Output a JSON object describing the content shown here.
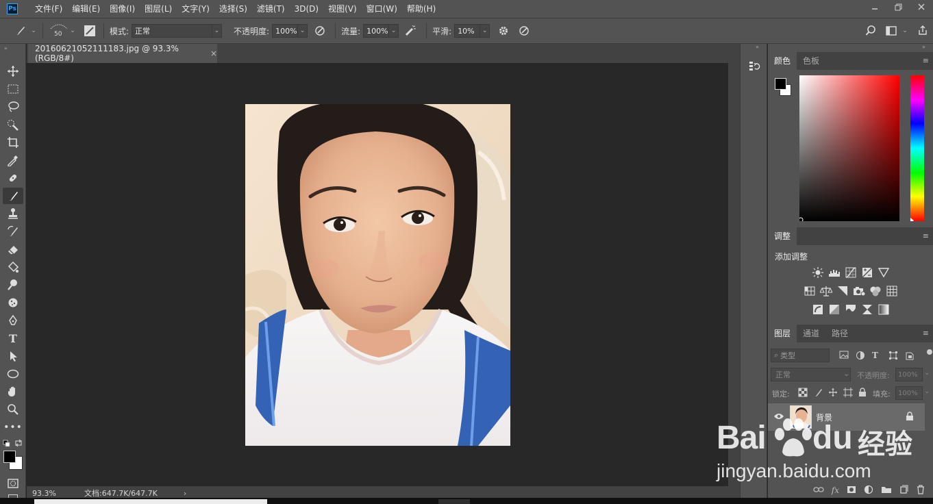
{
  "app": {
    "logo": "Ps",
    "menu": [
      "文件(F)",
      "编辑(E)",
      "图像(I)",
      "图层(L)",
      "文字(Y)",
      "选择(S)",
      "滤镜(T)",
      "3D(D)",
      "视图(V)",
      "窗口(W)",
      "帮助(H)"
    ],
    "window_controls": [
      "minimize-icon",
      "restore-icon",
      "close-icon"
    ]
  },
  "options": {
    "brush_size": "50",
    "mode_label": "模式:",
    "mode_value": "正常",
    "opacity_label": "不透明度:",
    "opacity_value": "100%",
    "flow_label": "流量:",
    "flow_value": "100%",
    "smoothing_label": "平滑:",
    "smoothing_value": "10%"
  },
  "document": {
    "tab_title": "20160621052111183.jpg @ 93.3%(RGB/8#)",
    "tab_close": "×",
    "zoom": "93.3%",
    "doc_size": "文档:647.7K/647.7K",
    "status_arrow": "›"
  },
  "color_panel": {
    "tabs": [
      "颜色",
      "色板"
    ],
    "foreground": "#000000",
    "background": "#ffffff",
    "hue": "#ff0000"
  },
  "adjustments_panel": {
    "tab": "调整",
    "title": "添加调整",
    "rows": [
      [
        "brightness-icon",
        "levels-icon",
        "curves-icon",
        "exposure-icon",
        "vibrance-icon"
      ],
      [
        "hue-saturation-icon",
        "color-balance-icon",
        "black-white-icon",
        "photo-filter-icon",
        "channel-mixer-icon",
        "color-lookup-icon"
      ],
      [
        "invert-icon",
        "posterize-icon",
        "threshold-icon",
        "selective-color-icon",
        "gradient-map-icon"
      ]
    ]
  },
  "layers_panel": {
    "tabs": [
      "图层",
      "通道",
      "路径"
    ],
    "filter_placeholder": "类型",
    "blend_mode": "正常",
    "opacity_label": "不透明度:",
    "opacity_value": "100%",
    "lock_label": "锁定:",
    "fill_label": "填充:",
    "fill_value": "100%",
    "layers": [
      {
        "name": "背景",
        "locked": true,
        "visible": true
      }
    ]
  },
  "watermark": {
    "brand": "Bai",
    "brand_suffix": "du",
    "cn": "经验",
    "url": "jingyan.baidu.com"
  }
}
